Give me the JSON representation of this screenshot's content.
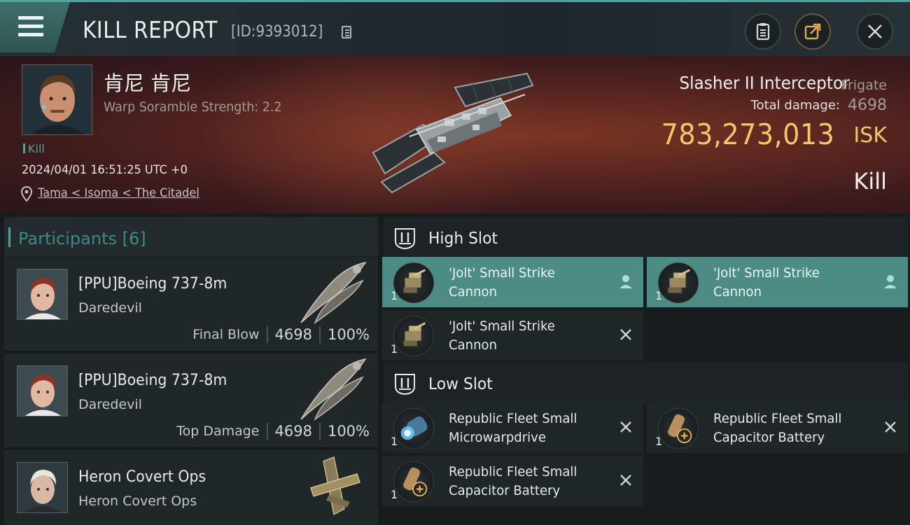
{
  "header": {
    "title": "KILL REPORT",
    "id_text": "[ID:9393012]"
  },
  "victim": {
    "name": "肯尼 肯尼",
    "subtitle": "Warp Soramble Strength: 2.2",
    "tag": "Kill",
    "timestamp": "2024/04/01 16:51:25 UTC +0",
    "location": "Tama < Isoma < The Citadel",
    "ship_name": "Slasher II Interceptor",
    "ship_class": "Frigate",
    "total_damage_label": "Total damage:",
    "total_damage": "4698",
    "isk_value": "783,273,013",
    "isk_unit": "ISK",
    "result": "Kill"
  },
  "participants": {
    "title": "Participants",
    "count": "[6]",
    "items": [
      {
        "name": "[PPU]Boeing 737-8m",
        "ship": "Daredevil",
        "label": "Final Blow",
        "damage": "4698",
        "percent": "100%"
      },
      {
        "name": "[PPU]Boeing 737-8m",
        "ship": "Daredevil",
        "label": "Top Damage",
        "damage": "4698",
        "percent": "100%"
      },
      {
        "name": "Heron Covert Ops",
        "ship": "Heron Covert Ops"
      }
    ]
  },
  "slots": {
    "high": {
      "title": "High Slot",
      "modules": [
        {
          "line1": "'Jolt' Small Strike",
          "line2": "Cannon",
          "qty": "1",
          "status": "dropped"
        },
        {
          "line1": "'Jolt' Small Strike",
          "line2": "Cannon",
          "qty": "1",
          "status": "dropped"
        },
        {
          "line1": "'Jolt' Small Strike",
          "line2": "Cannon",
          "qty": "1",
          "status": "destroyed"
        }
      ]
    },
    "low": {
      "title": "Low Slot",
      "modules": [
        {
          "line1": "Republic Fleet Small",
          "line2": "Microwarpdrive",
          "qty": "1",
          "status": "destroyed"
        },
        {
          "line1": "Republic Fleet Small",
          "line2": "Capacitor Battery",
          "qty": "1",
          "status": "destroyed"
        },
        {
          "line1": "Republic Fleet Small",
          "line2": "Capacitor Battery",
          "qty": "1",
          "status": "destroyed"
        }
      ]
    }
  },
  "icons": {
    "menu": "hamburger-icon",
    "copy": "copy-icon",
    "report": "clipboard-icon",
    "share": "share-icon",
    "close": "close-icon",
    "location": "pin-icon",
    "slot": "slot-icon",
    "dropped": "person-icon",
    "destroyed": "x-icon"
  },
  "colors": {
    "accent": "#4fa39a",
    "isk": "#f3c56c",
    "selected": "#4c8c84"
  }
}
